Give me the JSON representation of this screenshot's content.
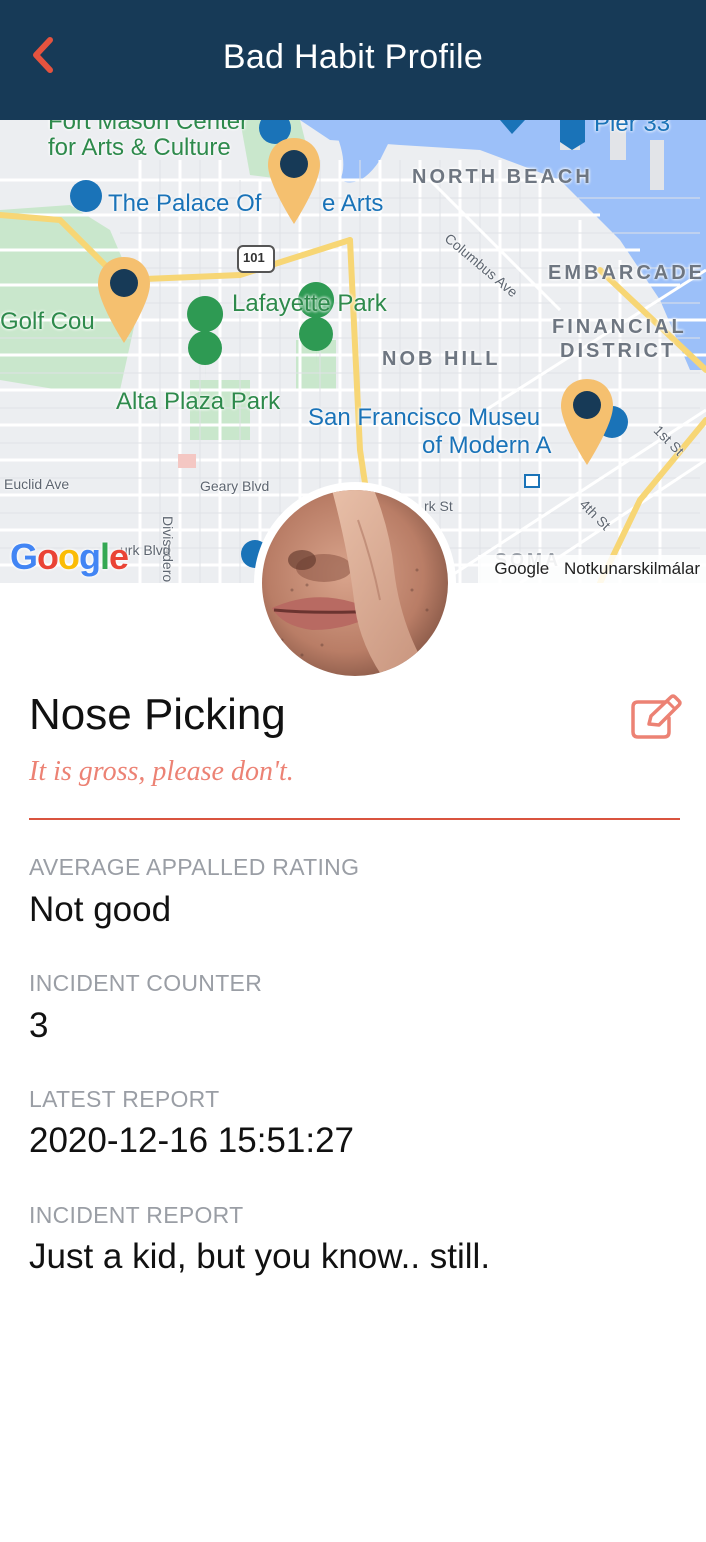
{
  "header": {
    "title": "Bad Habit Profile",
    "background": "#173a57",
    "back_icon": "chevron-left-icon",
    "back_color": "#e5533f"
  },
  "map": {
    "places": {
      "fort_mason_1": "Fort Mason Center",
      "fort_mason_2": "for Arts & Culture",
      "palace_1": "The Palace Of",
      "palace_2": "e Arts",
      "pier": "Pier 33",
      "north_beach": "NORTH BEACH",
      "embarcadero": "EMBARCADE",
      "financial_1": "FINANCIAL",
      "financial_2": "DISTRICT",
      "nob_hill": "NOB HILL",
      "lafayette": "Lafayette Park",
      "golf": "Golf Cou",
      "alta_plaza": "Alta Plaza Park",
      "sfmoma_1": "San Francisco Museu",
      "sfmoma_2": "of Modern A",
      "euclid": "Euclid Ave",
      "geary": "Geary Blvd",
      "columbus": "Columbus Ave",
      "divisadero": "Divisadero",
      "park_blvd": "urk Blvd",
      "first_st": "1st St",
      "fourth_st": "4th St",
      "hwy": "101",
      "soma": "SOMA",
      "st_partial": "rk St"
    },
    "google_logo": [
      "G",
      "o",
      "o",
      "g",
      "l",
      "e"
    ],
    "attribution": "Google",
    "terms": "Notkunarskilmálar",
    "pin_color": "#f5c06f",
    "pin_dot_color": "#173a57"
  },
  "profile": {
    "title": "Nose Picking",
    "subtitle": "It is gross, please don't.",
    "accent": "#e5533f",
    "edit_icon": "edit-icon",
    "fields": [
      {
        "label": "AVERAGE APPALLED RATING",
        "value": "Not good"
      },
      {
        "label": "INCIDENT COUNTER",
        "value": "3"
      },
      {
        "label": "LATEST REPORT",
        "value": "2020-12-16 15:51:27"
      },
      {
        "label": "INCIDENT REPORT",
        "value": "Just a kid, but you know.. still."
      }
    ]
  }
}
